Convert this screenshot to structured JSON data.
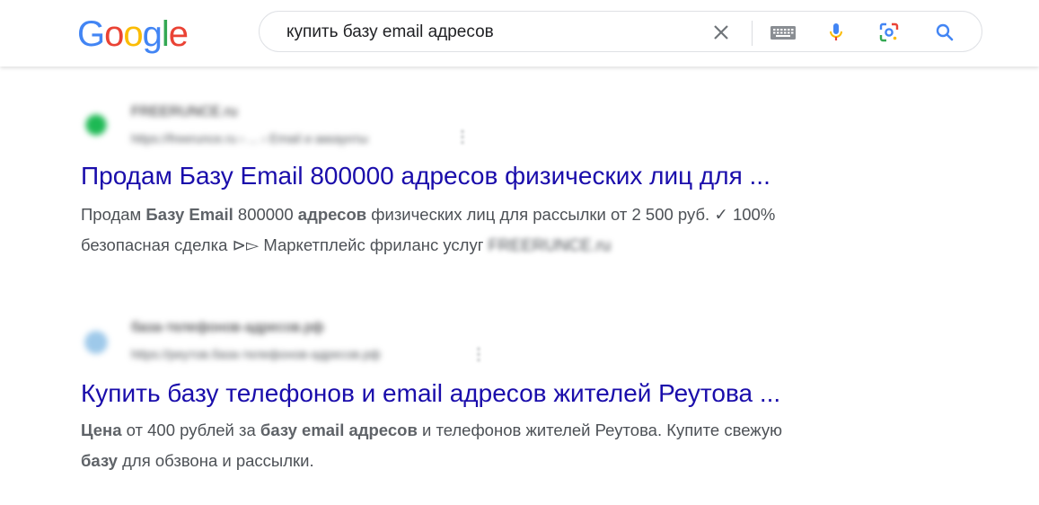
{
  "header": {
    "logo_letters": [
      "G",
      "o",
      "o",
      "g",
      "l",
      "e"
    ],
    "logo_colors": [
      "#4285f4",
      "#ea4335",
      "#fbbc05",
      "#4285f4",
      "#34a853",
      "#ea4335"
    ],
    "search": {
      "query": "купить базу email адресов"
    },
    "icons": [
      "close-icon",
      "keyboard-icon",
      "mic-icon",
      "lens-icon",
      "search-icon"
    ]
  },
  "results": [
    {
      "site_name": "FREERUNCE.ru",
      "site_url": "https://freerunce.ru › ... › Email и аккаунты",
      "title": "Продам Базу Email 800000 адресов физических лиц для ...",
      "snippet_1": {
        "t1": "Продам ",
        "b1": "Базу Email",
        "t2": " 800000 ",
        "b2": "адресов",
        "t3": " физических лиц для рассылки от 2 500 руб. ✓ 100%"
      },
      "snippet_2": {
        "t1": "безопасная сделка ⊳▻ Маркетплейс фриланс услуг ",
        "blurred": "FREERUNCE.ru"
      }
    },
    {
      "site_name": "база-телефонов-адресов.рф",
      "site_url": "https://реутов.база-телефонов-адресов.рф",
      "title": "Купить базу телефонов и email адресов жителей Реутова ...",
      "snippet_1": {
        "b1": "Цена",
        "t1": " от 400 рублей за ",
        "b2": "базу email адресов",
        "t2": " и телефонов жителей Реутова. Купите свежую"
      },
      "snippet_2": {
        "b1": "базу",
        "t1": " для обзвона и рассылки."
      }
    }
  ],
  "colors": {
    "link": "#1a0dab",
    "snippet": "#4d5156"
  }
}
